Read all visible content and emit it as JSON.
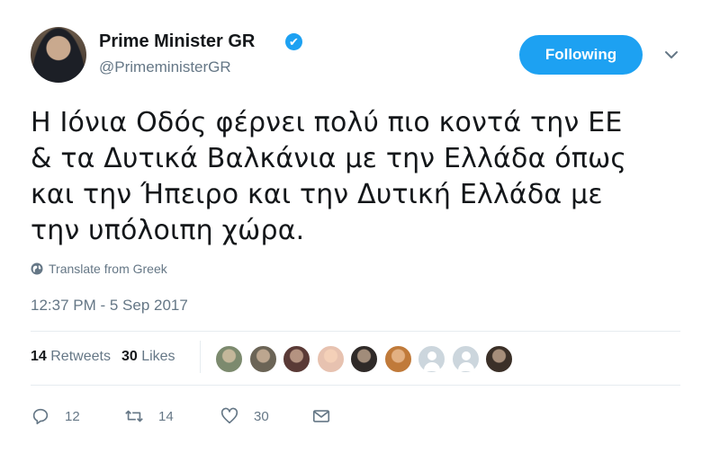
{
  "author": {
    "name": "Prime Minister GR",
    "handle": "@PrimeministerGR",
    "verified_badge": "✔"
  },
  "follow_button": {
    "label": "Following"
  },
  "tweet": {
    "lines": [
      "Η Ιόνια Οδός φέρνει πολύ πιο κοντά την ΕΕ",
      "& τα Δυτικά Βαλκάνια με την Ελλάδα όπως",
      "και την Ήπειρο και την Δυτική Ελλάδα με",
      "την υπόλοιπη χώρα."
    ],
    "translate_label": "Translate from Greek",
    "timestamp": "12:37 PM - 5 Sep 2017"
  },
  "stats": {
    "retweets_count": "14",
    "retweets_label": "Retweets",
    "likes_count": "30",
    "likes_label": "Likes"
  },
  "likers": [
    {
      "color": "#7c8a6e"
    },
    {
      "color": "#6b6456"
    },
    {
      "color": "#5a3a36"
    },
    {
      "color": "#e7c2b0"
    },
    {
      "color": "#2f2a28"
    },
    {
      "color": "#c07a3a"
    },
    {
      "color": "default"
    },
    {
      "color": "default"
    },
    {
      "color": "#3b3028"
    }
  ],
  "actions": {
    "reply_count": "12",
    "retweet_count": "14",
    "like_count": "30",
    "icons": [
      "reply-icon",
      "retweet-icon",
      "like-icon",
      "message-icon"
    ]
  },
  "colors": {
    "accent": "#1da1f2",
    "secondary_text": "#657786",
    "primary_text": "#14171a",
    "divider": "#e6ecf0"
  }
}
